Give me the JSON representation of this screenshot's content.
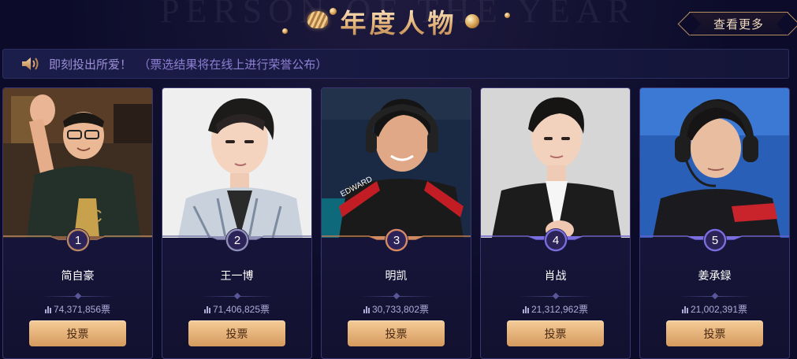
{
  "header": {
    "watermark": "PERSON OF THE YEAR",
    "title": "年度人物",
    "more_button": "查看更多"
  },
  "notice": {
    "text": "即刻投出所爱！",
    "subtext": "（票选结果将在线上进行荣誉公布）",
    "icon": "speaker-icon"
  },
  "vote_icon": "bar-chart-icon",
  "candidates": [
    {
      "rank": "1",
      "name": "简自豪",
      "votes": "74,371,856票",
      "button": "投票",
      "rank_color": "#b98762"
    },
    {
      "rank": "2",
      "name": "王一博",
      "votes": "71,406,825票",
      "button": "投票",
      "rank_color": "#7a7aa8"
    },
    {
      "rank": "3",
      "name": "明凯",
      "votes": "30,733,802票",
      "button": "投票",
      "rank_color": "#c07a52"
    },
    {
      "rank": "4",
      "name": "肖战",
      "votes": "21,312,962票",
      "button": "投票",
      "rank_color": "#6b5fd0"
    },
    {
      "rank": "5",
      "name": "姜承録",
      "votes": "21,002,391票",
      "button": "投票",
      "rank_color": "#6b5fd0"
    }
  ],
  "colors": {
    "background": "#0c0c2a",
    "card": "#1c1a46",
    "accent_gold": "#e6b77d",
    "button": "#e7b47a",
    "notice_text": "#9d8ed6"
  }
}
